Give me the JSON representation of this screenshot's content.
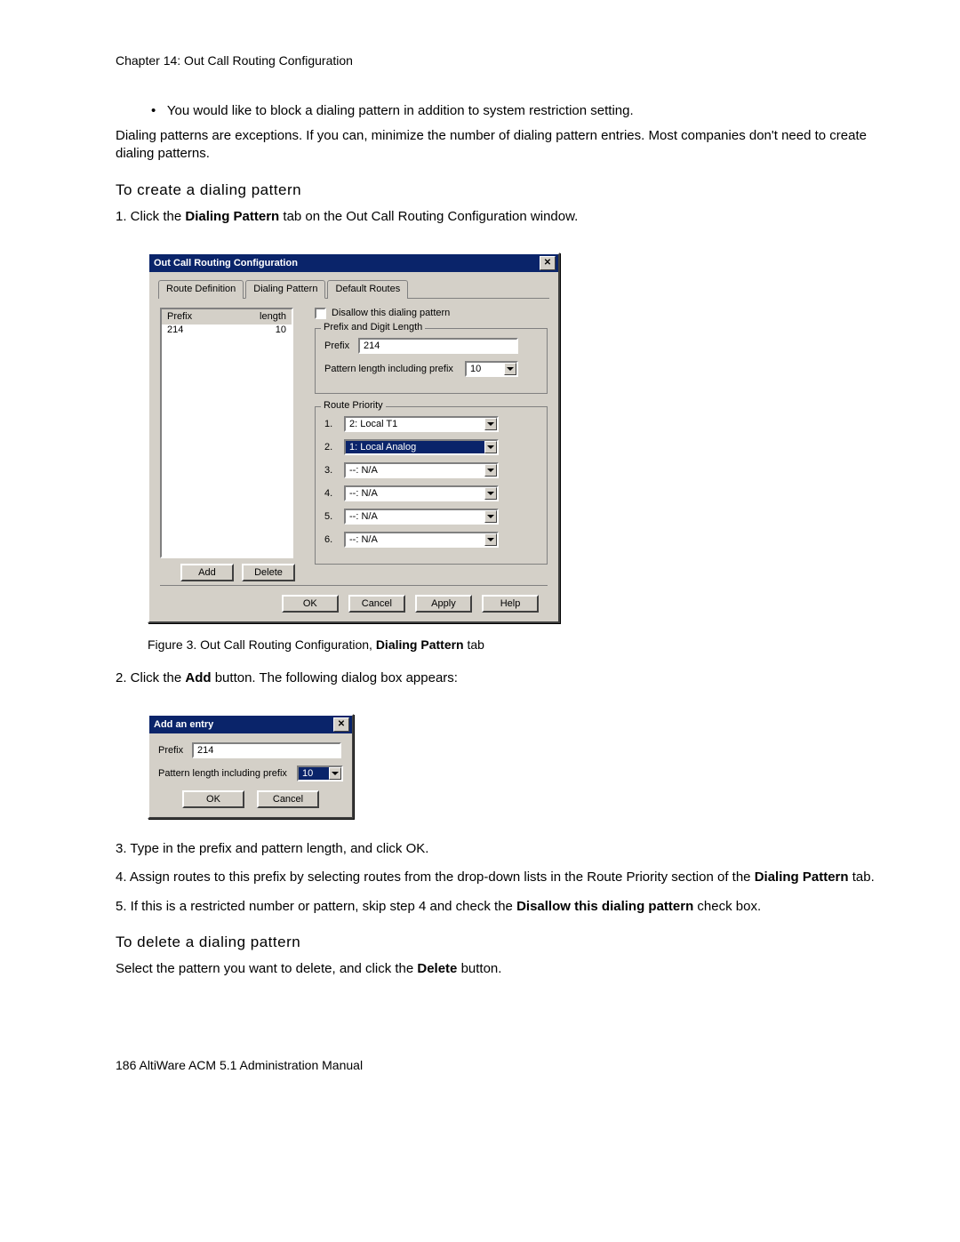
{
  "chapter": "Chapter 14:  Out Call Routing Configuration",
  "bullet1": "You would like to block a dialing pattern in addition to system restriction setting.",
  "para1": "Dialing patterns are exceptions. If you can, minimize the number of dialing pattern entries. Most companies don't need to create dialing patterns.",
  "heading_create": "To create a dialing pattern",
  "step1_pre": "1.  Click the ",
  "step1_bold": "Dialing Pattern",
  "step1_post": " tab on the Out Call Routing Configuration window.",
  "dlg1": {
    "title": "Out Call Routing Configuration",
    "tabs": [
      "Route Definition",
      "Dialing Pattern",
      "Default Routes"
    ],
    "list": {
      "headers": [
        "Prefix",
        "length"
      ],
      "rows": [
        [
          "214",
          "10"
        ]
      ]
    },
    "buttons": {
      "add": "Add",
      "delete": "Delete"
    },
    "disallow_label": "Disallow this dialing pattern",
    "group_prefix": "Prefix and Digit Length",
    "prefix_label": "Prefix",
    "prefix_value": "214",
    "pattern_label": "Pattern length including prefix",
    "pattern_value": "10",
    "group_route": "Route Priority",
    "routes": [
      {
        "n": "1.",
        "v": "2: Local T1",
        "sel": false
      },
      {
        "n": "2.",
        "v": "1: Local Analog",
        "sel": true
      },
      {
        "n": "3.",
        "v": "--: N/A",
        "sel": false
      },
      {
        "n": "4.",
        "v": "--: N/A",
        "sel": false
      },
      {
        "n": "5.",
        "v": "--: N/A",
        "sel": false
      },
      {
        "n": "6.",
        "v": "--: N/A",
        "sel": false
      }
    ],
    "footer": {
      "ok": "OK",
      "cancel": "Cancel",
      "apply": "Apply",
      "help": "Help"
    }
  },
  "figure_caption_pre": "Figure 3.   Out Call Routing Configuration, ",
  "figure_caption_bold": "Dialing Pattern",
  "figure_caption_post": " tab",
  "step2_pre": "2.  Click the ",
  "step2_bold": "Add",
  "step2_post": " button. The following dialog box appears:",
  "dlg2": {
    "title": "Add an entry",
    "prefix_label": "Prefix",
    "prefix_value": "214",
    "pattern_label": "Pattern length including prefix",
    "pattern_value": "10",
    "ok": "OK",
    "cancel": "Cancel"
  },
  "step3": "3.  Type in the prefix and pattern length, and click OK.",
  "step4_pre": "4.  Assign routes to this prefix by selecting routes from the drop-down lists in the Route Priority section of the ",
  "step4_bold": "Dialing Pattern",
  "step4_post": " tab.",
  "step5_pre": "5.  If this is a restricted number or pattern, skip step 4 and check the ",
  "step5_bold": "Disallow this dialing pattern",
  "step5_post": " check box.",
  "heading_delete": "To delete a dialing pattern",
  "delete_para_pre": "Select the pattern you want to delete, and click the ",
  "delete_para_bold": "Delete",
  "delete_para_post": " button.",
  "footer": "186   AltiWare ACM 5.1 Administration Manual"
}
